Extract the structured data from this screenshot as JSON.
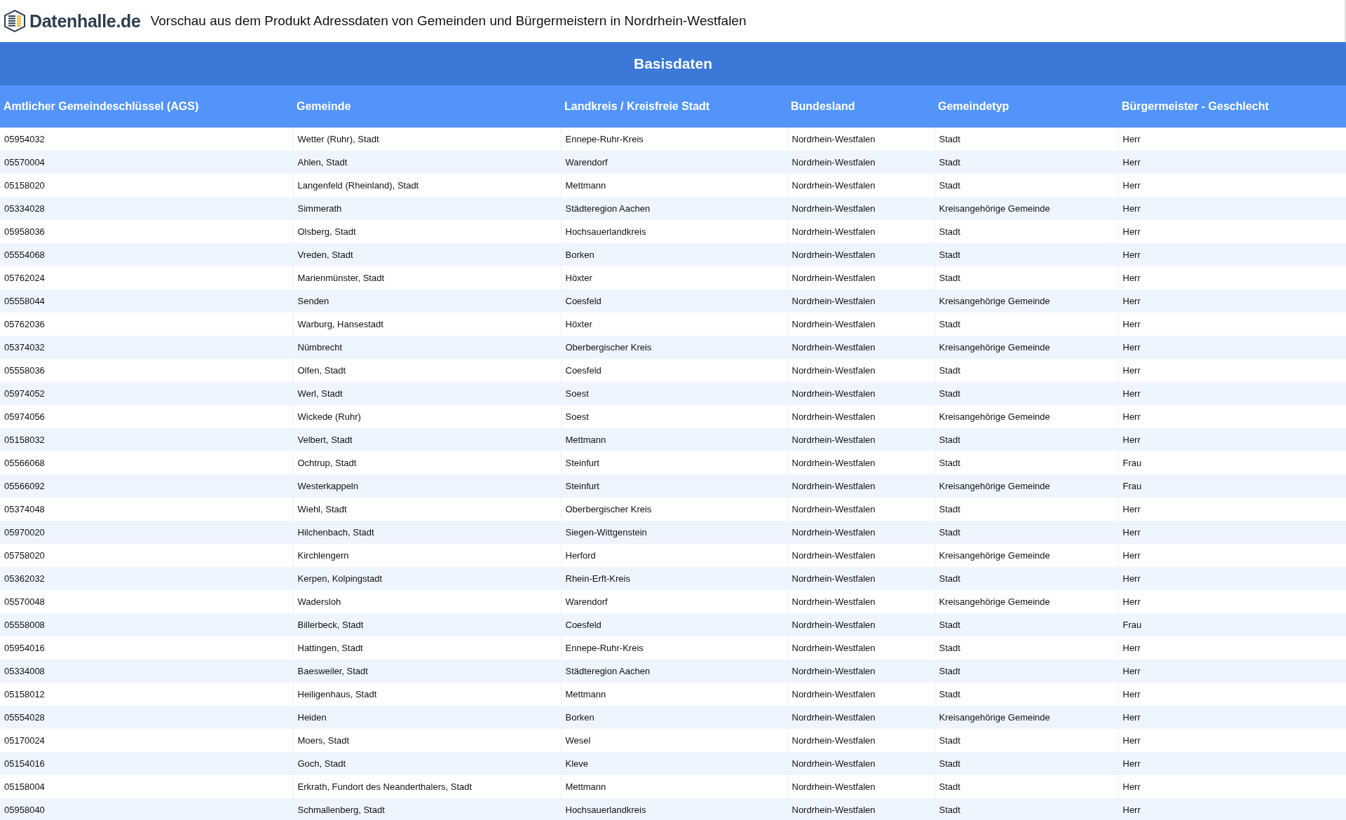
{
  "header": {
    "logo_text": "Datenhalle.de",
    "title": "Vorschau aus dem Produkt Adressdaten von Gemeinden und Bürgermeistern in Nordrhein-Westfalen"
  },
  "table": {
    "group_title": "Basisdaten",
    "columns": [
      "Amtlicher Gemeindeschlüssel (AGS)",
      "Gemeinde",
      "Landkreis / Kreisfreie Stadt",
      "Bundesland",
      "Gemeindetyp",
      "Bürgermeister - Geschlecht"
    ],
    "rows": [
      [
        "05954032",
        "Wetter (Ruhr), Stadt",
        "Ennepe-Ruhr-Kreis",
        "Nordrhein-Westfalen",
        "Stadt",
        "Herr"
      ],
      [
        "05570004",
        "Ahlen, Stadt",
        "Warendorf",
        "Nordrhein-Westfalen",
        "Stadt",
        "Herr"
      ],
      [
        "05158020",
        "Langenfeld (Rheinland), Stadt",
        "Mettmann",
        "Nordrhein-Westfalen",
        "Stadt",
        "Herr"
      ],
      [
        "05334028",
        "Simmerath",
        "Städteregion Aachen",
        "Nordrhein-Westfalen",
        "Kreisangehörige Gemeinde",
        "Herr"
      ],
      [
        "05958036",
        "Olsberg, Stadt",
        "Hochsauerlandkreis",
        "Nordrhein-Westfalen",
        "Stadt",
        "Herr"
      ],
      [
        "05554068",
        "Vreden, Stadt",
        "Borken",
        "Nordrhein-Westfalen",
        "Stadt",
        "Herr"
      ],
      [
        "05762024",
        "Marienmünster, Stadt",
        "Höxter",
        "Nordrhein-Westfalen",
        "Stadt",
        "Herr"
      ],
      [
        "05558044",
        "Senden",
        "Coesfeld",
        "Nordrhein-Westfalen",
        "Kreisangehörige Gemeinde",
        "Herr"
      ],
      [
        "05762036",
        "Warburg, Hansestadt",
        "Höxter",
        "Nordrhein-Westfalen",
        "Stadt",
        "Herr"
      ],
      [
        "05374032",
        "Nümbrecht",
        "Oberbergischer Kreis",
        "Nordrhein-Westfalen",
        "Kreisangehörige Gemeinde",
        "Herr"
      ],
      [
        "05558036",
        "Olfen, Stadt",
        "Coesfeld",
        "Nordrhein-Westfalen",
        "Stadt",
        "Herr"
      ],
      [
        "05974052",
        "Werl, Stadt",
        "Soest",
        "Nordrhein-Westfalen",
        "Stadt",
        "Herr"
      ],
      [
        "05974056",
        "Wickede (Ruhr)",
        "Soest",
        "Nordrhein-Westfalen",
        "Kreisangehörige Gemeinde",
        "Herr"
      ],
      [
        "05158032",
        "Velbert, Stadt",
        "Mettmann",
        "Nordrhein-Westfalen",
        "Stadt",
        "Herr"
      ],
      [
        "05566068",
        "Ochtrup, Stadt",
        "Steinfurt",
        "Nordrhein-Westfalen",
        "Stadt",
        "Frau"
      ],
      [
        "05566092",
        "Westerkappeln",
        "Steinfurt",
        "Nordrhein-Westfalen",
        "Kreisangehörige Gemeinde",
        "Frau"
      ],
      [
        "05374048",
        "Wiehl, Stadt",
        "Oberbergischer Kreis",
        "Nordrhein-Westfalen",
        "Stadt",
        "Herr"
      ],
      [
        "05970020",
        "Hilchenbach, Stadt",
        "Siegen-Wittgenstein",
        "Nordrhein-Westfalen",
        "Stadt",
        "Herr"
      ],
      [
        "05758020",
        "Kirchlengern",
        "Herford",
        "Nordrhein-Westfalen",
        "Kreisangehörige Gemeinde",
        "Herr"
      ],
      [
        "05362032",
        "Kerpen, Kolpingstadt",
        "Rhein-Erft-Kreis",
        "Nordrhein-Westfalen",
        "Stadt",
        "Herr"
      ],
      [
        "05570048",
        "Wadersloh",
        "Warendorf",
        "Nordrhein-Westfalen",
        "Kreisangehörige Gemeinde",
        "Herr"
      ],
      [
        "05558008",
        "Billerbeck, Stadt",
        "Coesfeld",
        "Nordrhein-Westfalen",
        "Stadt",
        "Frau"
      ],
      [
        "05954016",
        "Hattingen, Stadt",
        "Ennepe-Ruhr-Kreis",
        "Nordrhein-Westfalen",
        "Stadt",
        "Herr"
      ],
      [
        "05334008",
        "Baesweiler, Stadt",
        "Städteregion Aachen",
        "Nordrhein-Westfalen",
        "Stadt",
        "Herr"
      ],
      [
        "05158012",
        "Heiligenhaus, Stadt",
        "Mettmann",
        "Nordrhein-Westfalen",
        "Stadt",
        "Herr"
      ],
      [
        "05554028",
        "Heiden",
        "Borken",
        "Nordrhein-Westfalen",
        "Kreisangehörige Gemeinde",
        "Herr"
      ],
      [
        "05170024",
        "Moers, Stadt",
        "Wesel",
        "Nordrhein-Westfalen",
        "Stadt",
        "Herr"
      ],
      [
        "05154016",
        "Goch, Stadt",
        "Kleve",
        "Nordrhein-Westfalen",
        "Stadt",
        "Herr"
      ],
      [
        "05158004",
        "Erkrath, Fundort des Neanderthalers, Stadt",
        "Mettmann",
        "Nordrhein-Westfalen",
        "Stadt",
        "Herr"
      ],
      [
        "05958040",
        "Schmallenberg, Stadt",
        "Hochsauerlandkreis",
        "Nordrhein-Westfalen",
        "Stadt",
        "Herr"
      ]
    ]
  }
}
